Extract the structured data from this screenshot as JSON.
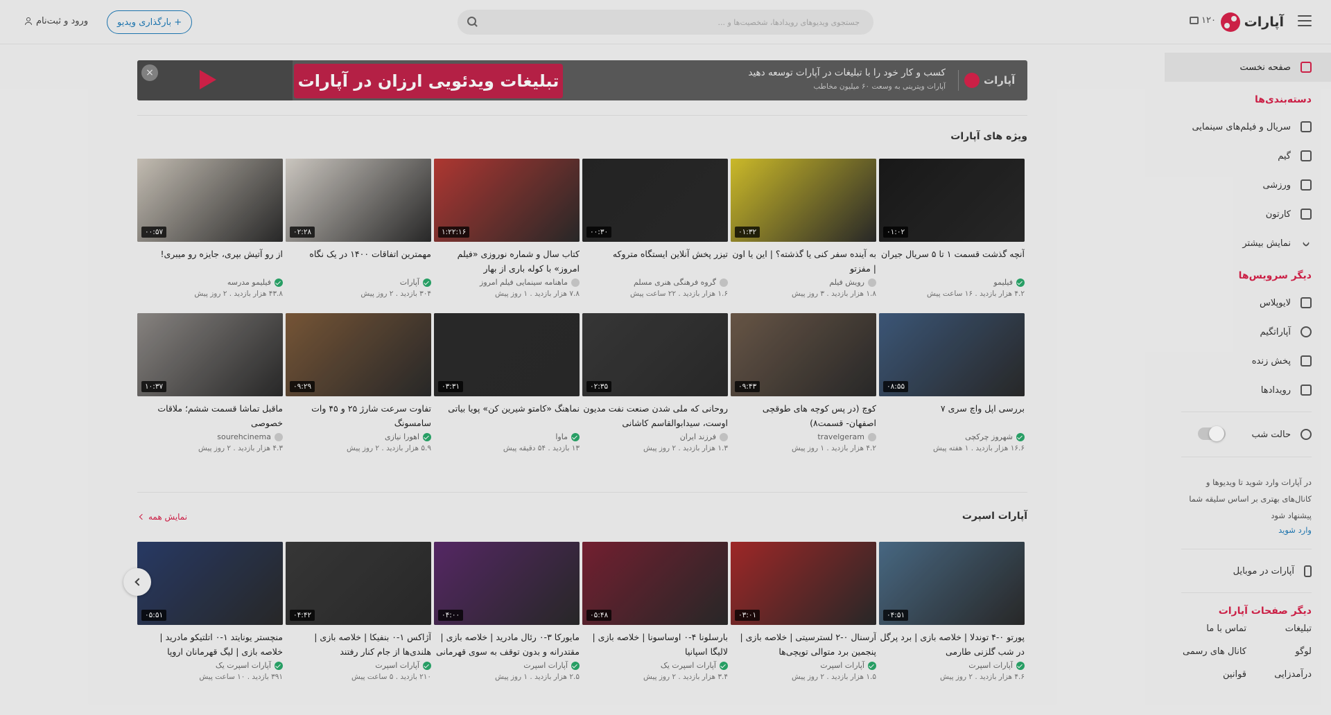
{
  "header": {
    "logo_text": "آپارات",
    "points": "۱۲۰",
    "search_placeholder": "جستجوی ویدیوهای رویدادها، شخصیت‌ها و ...",
    "upload_label": "+ بارگذاری ویدیو",
    "login_label": "ورود و ثبت‌نام"
  },
  "sidebar": {
    "home": "صفحه نخست",
    "categories_title": "دسته‌بندی‌ها",
    "categories": [
      "سریال و فیلم‌های سینمایی",
      "گیم",
      "ورزشی",
      "کارتون",
      "نمایش بیشتر"
    ],
    "services_title": "دیگر سرویس‌ها",
    "services": [
      "لایوپلاس",
      "آپاراتگیم",
      "پخش زنده",
      "رویدادها"
    ],
    "night_mode": "حالت شب",
    "hint": "در آپارات وارد شوید تا ویدیوها و کانال‌های بهتری بر اساس سلیقه شما پیشنهاد شود",
    "login_link": "وارد شوید",
    "mobile": "آپارات در موبایل",
    "other_pages_title": "دیگر صفحات آپارات",
    "other_pages": [
      "تبلیغات",
      "تماس با ما",
      "لوگو",
      "کانال های رسمی",
      "درآمدزایی",
      "قوانین"
    ]
  },
  "banner": {
    "brand": "آپارات",
    "title": "کسب و کار خود را با تبلیغات در آپارات توسعه دهید",
    "subtitle": "آپارات ویترینی به وسعت ۶۰ میلیون مخاطب",
    "headline": "تبلیغات ویدئویی ارزان در آپارات",
    "close": "×"
  },
  "special": {
    "title": "ویژه های آپارات",
    "rows": [
      [
        {
          "title": "از رو آتیش بپری، جایزه رو میبری!",
          "channel": "فیلیمو مدرسه",
          "verified": true,
          "meta": "۴۳.۸ هزار بازدید . ۲ روز پیش",
          "duration": "۰۰:۵۷",
          "color": "#cfc8bd"
        },
        {
          "title": "مهمترین اتفاقات ۱۴۰۰ در یک نگاه",
          "channel": "آپارات",
          "verified": true,
          "meta": "۳۰۴ بازدید . ۲ روز پیش",
          "duration": "۰۲:۲۸",
          "color": "#d7d2cb"
        },
        {
          "title": "کتاب سال و شماره نوروزی «فیلم امروز» با کوله باری از بهار",
          "channel": "ماهنامه سینمایی فیلم امروز",
          "verified": false,
          "meta": "۷.۸ هزار بازدید . ۱ روز پیش",
          "duration": "۱:۲۲:۱۶",
          "color": "#b93b35"
        },
        {
          "title": "تیزر پخش آنلاین ایستگاه متروکه",
          "channel": "گروه فرهنگی هنری مسلم",
          "verified": false,
          "meta": "۱.۶ هزار بازدید . ۲۲ ساعت پیش",
          "duration": "۰۰:۳۰",
          "color": "#262626"
        },
        {
          "title": "به آینده سفر کنی یا گذشته؟ | این یا اون | مفزتو",
          "channel": "رویش فیلم",
          "verified": false,
          "meta": "۱.۸ هزار بازدید . ۳ روز پیش",
          "duration": "۰۱:۳۲",
          "color": "#d8c52c"
        },
        {
          "title": "آنچه گذشت قسمت ۱ تا ۵ سریال جیران",
          "channel": "فیلیمو",
          "verified": true,
          "meta": "۴.۲ هزار بازدید . ۱۶ ساعت پیش",
          "duration": "۰۱:۰۲",
          "color": "#1a1a1a"
        }
      ],
      [
        {
          "title": "ماقبل تماشا قسمت ششم؛ ملاقات خصوصی",
          "channel": "sourehcinema",
          "verified": false,
          "meta": "۴.۳ هزار بازدید . ۲ روز پیش",
          "duration": "۱۰:۳۷",
          "color": "#8f8b88"
        },
        {
          "title": "تفاوت سرعت شارژ ۲۵ و ۴۵ وات سامسونگ",
          "channel": "اهورا نیازی",
          "verified": true,
          "meta": "۵.۹ هزار بازدید . ۲ روز پیش",
          "duration": "۰۹:۲۹",
          "color": "#7d5a3a"
        },
        {
          "title": "نماهنگ «کامتو شیرین کن» پویا بیاتی",
          "channel": "ماوا",
          "verified": true,
          "meta": "۱۳ بازدید . ۵۴ دقیقه پیش",
          "duration": "۰۳:۳۱",
          "color": "#2b2b2b"
        },
        {
          "title": "روحانی که ملی شدن صنعت نفت مدیون اوست، سیدابوالقاسم کاشانی",
          "channel": "فرزند ایران",
          "verified": false,
          "meta": "۱.۳ هزار بازدید . ۲ روز پیش",
          "duration": "۰۲:۳۵",
          "color": "#3a3a3a"
        },
        {
          "title": "کوچ (در پس کوچه های طوقچی اصفهان- قسمت۸)",
          "channel": "travelgeram",
          "verified": false,
          "meta": "۴.۲ هزار بازدید . ۱ روز پیش",
          "duration": "۰۹:۴۳",
          "color": "#6d5a4a"
        },
        {
          "title": "بررسی اپل واچ سری ۷",
          "channel": "شهروز چرکچی",
          "verified": true,
          "meta": "۱۶.۶ هزار بازدید . ۱ هفته پیش",
          "duration": "۰۸:۵۵",
          "color": "#3f5b7e"
        }
      ]
    ]
  },
  "sport": {
    "title": "آپارات اسپرت",
    "show_all": "نمایش همه",
    "items": [
      {
        "title": "منچستر یونایتد ۱-۰ اتلتیکو مادرید | خلاصه بازی | لیگ قهرمانان اروپا",
        "channel": "آپارات اسپرت یک",
        "verified": true,
        "meta": "۳۹۱ بازدید . ۱۰ ساعت پیش",
        "duration": "۰۵:۵۱",
        "color": "#2a3d6a"
      },
      {
        "title": "آژاکس ۱-۰ بنفیکا | خلاصه بازی | هلندی‌ها از جام کنار رفتند",
        "channel": "آپارات اسپرت",
        "verified": true,
        "meta": "۲۱۰ بازدید . ۵ ساعت پیش",
        "duration": "۰۴:۴۲",
        "color": "#3a3a3a"
      },
      {
        "title": "مایورکا ۳-۰ رئال مادرید | خلاصه بازی | مقتدرانه و بدون توقف به سوی قهرمانی",
        "channel": "آپارات اسپرت",
        "verified": true,
        "meta": "۲.۵ هزار بازدید . ۱ روز پیش",
        "duration": "۰۴:۰۰",
        "color": "#5a2a6a"
      },
      {
        "title": "بارسلونا ۴-۰ اوساسونا | خلاصه بازی | لالیگا اسپانیا",
        "channel": "آپارات اسپرت یک",
        "verified": true,
        "meta": "۳.۴ هزار بازدید . ۲ روز پیش",
        "duration": "۰۵:۴۸",
        "color": "#7a2233"
      },
      {
        "title": "آرسنال ۰-۲ لسترسیتی | خلاصه بازی | پنجمین برد متوالی توپچی‌ها",
        "channel": "آپارات اسپرت",
        "verified": true,
        "meta": "۱.۵ هزار بازدید . ۲ روز پیش",
        "duration": "۰۳:۰۱",
        "color": "#a82a2a"
      },
      {
        "title": "پورتو ۰-۴ توندلا | خلاصه بازی | برد پرگل در شب گلزنی طارمی",
        "channel": "آپارات اسپرت",
        "verified": true,
        "meta": "۴.۶ هزار بازدید . ۲ روز پیش",
        "duration": "۰۴:۵۱",
        "color": "#4c6e8a"
      }
    ]
  }
}
